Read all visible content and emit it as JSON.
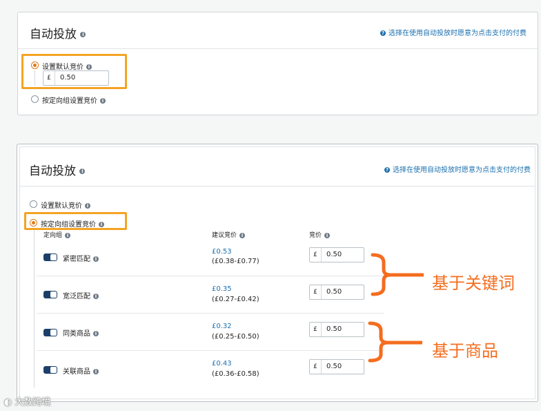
{
  "panel1": {
    "title": "自动投放",
    "help_text": "选择在使用自动投放时愿意为点击支付的付费",
    "options": {
      "default_bid_label": "设置默认竞价",
      "group_bid_label": "按定向组设置竞价",
      "selected": "default_bid"
    },
    "default_bid": {
      "currency": "£",
      "value": "0.50"
    }
  },
  "panel2": {
    "title": "自动投放",
    "help_text": "选择在使用自动投放时愿意为点击支付的付费",
    "options": {
      "default_bid_label": "设置默认竞价",
      "group_bid_label": "按定向组设置竞价",
      "selected": "group_bid"
    },
    "columns": {
      "group": "定向组",
      "suggested": "建议竞价",
      "bid": "竞价"
    },
    "rows": [
      {
        "name": "紧密匹配",
        "enabled": true,
        "suggested": "£0.53",
        "range": "(£0.38-£0.77)",
        "currency": "£",
        "bid": "0.50"
      },
      {
        "name": "宽泛匹配",
        "enabled": true,
        "suggested": "£0.35",
        "range": "(£0.27-£0.42)",
        "currency": "£",
        "bid": "0.50"
      },
      {
        "name": "同类商品",
        "enabled": true,
        "suggested": "£0.32",
        "range": "(£0.25-£0.50)",
        "currency": "£",
        "bid": "0.50"
      },
      {
        "name": "关联商品",
        "enabled": true,
        "suggested": "£0.43",
        "range": "(£0.36-£0.58)",
        "currency": "£",
        "bid": "0.50"
      }
    ]
  },
  "annotations": {
    "keyword_label": "基于关键词",
    "product_label": "基于商品",
    "color": "#f46d1f"
  },
  "highlight_color": "#f4a323",
  "watermark": "大数跨境"
}
